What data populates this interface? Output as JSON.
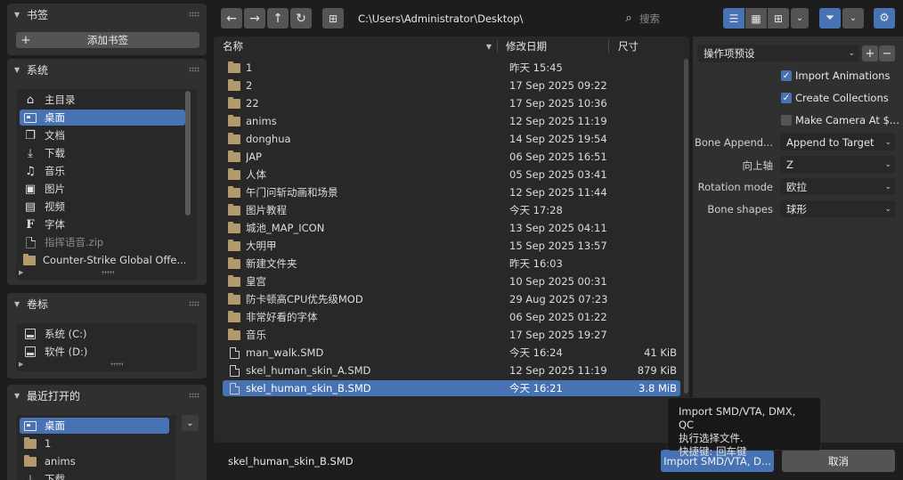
{
  "sidebar": {
    "bookmarks": {
      "title": "书签",
      "add_label": "添加书签"
    },
    "system": {
      "title": "系统",
      "items": [
        {
          "label": "主目录",
          "icon": "home-icon"
        },
        {
          "label": "桌面",
          "icon": "desktop-icon"
        },
        {
          "label": "文档",
          "icon": "documents-icon"
        },
        {
          "label": "下载",
          "icon": "download-icon"
        },
        {
          "label": "音乐",
          "icon": "music-icon"
        },
        {
          "label": "图片",
          "icon": "image-icon"
        },
        {
          "label": "视频",
          "icon": "video-icon"
        },
        {
          "label": "字体",
          "icon": "font-icon"
        },
        {
          "label": "指挥语音.zip",
          "icon": "file-icon"
        },
        {
          "label": "Counter-Strike Global Offe...",
          "icon": "folder-icon"
        }
      ]
    },
    "volumes": {
      "title": "卷标",
      "items": [
        {
          "label": "系统 (C:)"
        },
        {
          "label": "软件 (D:)"
        }
      ]
    },
    "recent": {
      "title": "最近打开的",
      "items": [
        {
          "label": "桌面"
        },
        {
          "label": "1"
        },
        {
          "label": "anims"
        },
        {
          "label": "下载"
        }
      ]
    }
  },
  "toolbar": {
    "path": "C:\\Users\\Administrator\\Desktop\\",
    "search_placeholder": "搜索"
  },
  "filelist": {
    "headers": {
      "name": "名称",
      "date": "修改日期",
      "size": "尺寸"
    },
    "rows": [
      {
        "name": "1",
        "date": "昨天 15:45",
        "size": "",
        "type": "folder"
      },
      {
        "name": "2",
        "date": "17 Sep 2025 09:22",
        "size": "",
        "type": "folder"
      },
      {
        "name": "22",
        "date": "17 Sep 2025 10:36",
        "size": "",
        "type": "folder"
      },
      {
        "name": "anims",
        "date": "12 Sep 2025 11:19",
        "size": "",
        "type": "folder"
      },
      {
        "name": "donghua",
        "date": "14 Sep 2025 19:54",
        "size": "",
        "type": "folder"
      },
      {
        "name": "JAP",
        "date": "06 Sep 2025 16:51",
        "size": "",
        "type": "folder"
      },
      {
        "name": "人体",
        "date": "05 Sep 2025 03:41",
        "size": "",
        "type": "folder"
      },
      {
        "name": "午门问斩动画和场景",
        "date": "12 Sep 2025 11:44",
        "size": "",
        "type": "folder"
      },
      {
        "name": "图片教程",
        "date": "今天 17:28",
        "size": "",
        "type": "folder"
      },
      {
        "name": "城池_MAP_ICON",
        "date": "13 Sep 2025 04:11",
        "size": "",
        "type": "folder"
      },
      {
        "name": "大明甲",
        "date": "15 Sep 2025 13:57",
        "size": "",
        "type": "folder"
      },
      {
        "name": "新建文件夹",
        "date": "昨天 16:03",
        "size": "",
        "type": "folder"
      },
      {
        "name": "皇宫",
        "date": "10 Sep 2025 00:31",
        "size": "",
        "type": "folder"
      },
      {
        "name": "防卡顿高CPU优先级MOD",
        "date": "29 Aug 2025 07:23",
        "size": "",
        "type": "folder"
      },
      {
        "name": "非常好看的字体",
        "date": "06 Sep 2025 01:22",
        "size": "",
        "type": "folder"
      },
      {
        "name": "音乐",
        "date": "17 Sep 2025 19:27",
        "size": "",
        "type": "folder"
      },
      {
        "name": "man_walk.SMD",
        "date": "今天 16:24",
        "size": "41 KiB",
        "type": "file"
      },
      {
        "name": "skel_human_skin_A.SMD",
        "date": "12 Sep 2025 11:19",
        "size": "879 KiB",
        "type": "file"
      },
      {
        "name": "skel_human_skin_B.SMD",
        "date": "今天 16:21",
        "size": "3.8 MiB",
        "type": "file",
        "selected": true
      }
    ]
  },
  "operator": {
    "preset_label": "操作项预设",
    "checkboxes": [
      {
        "label": "Import Animations",
        "checked": true
      },
      {
        "label": "Create Collections",
        "checked": true
      },
      {
        "label": "Make Camera At $...",
        "checked": false
      }
    ],
    "props": [
      {
        "label": "Bone Append...",
        "value": "Append to Target"
      },
      {
        "label": "向上轴",
        "value": "Z"
      },
      {
        "label": "Rotation mode",
        "value": "欧拉"
      },
      {
        "label": "Bone shapes",
        "value": "球形"
      }
    ]
  },
  "bottom": {
    "filename": "skel_human_skin_B.SMD",
    "import_label": "Import SMD/VTA, D...",
    "cancel_label": "取消"
  },
  "tooltip": {
    "line1": "Import SMD/VTA, DMX, QC",
    "line2": "执行选择文件.",
    "line3": "快捷键: 回车键"
  },
  "colors": {
    "accent": "#4772b3",
    "folder": "#b29a6c",
    "panel": "#303030",
    "field": "#282828"
  }
}
